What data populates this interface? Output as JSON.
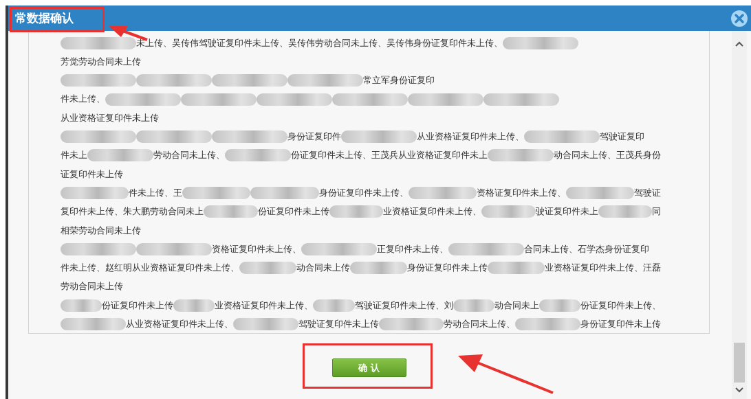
{
  "dialog": {
    "title": "常数据确认",
    "lines": [
      {
        "segments": [
          {
            "kind": "blur"
          },
          {
            "kind": "text",
            "text": "未上传、吴传伟驾驶证复印件未上传、吴传伟劳动合同未上传、吴传伟身份证复印件未上传、"
          },
          {
            "kind": "blur"
          }
        ]
      },
      {
        "segments": [
          {
            "kind": "text",
            "text": "芳觉劳动合同未上传"
          }
        ]
      },
      {
        "segments": [
          {
            "kind": "blur"
          },
          {
            "kind": "blur"
          },
          {
            "kind": "blur"
          },
          {
            "kind": "blur"
          },
          {
            "kind": "text",
            "text": "常立军身份证复印"
          }
        ]
      },
      {
        "segments": [
          {
            "kind": "text",
            "text": "件未上传、"
          },
          {
            "kind": "blur"
          },
          {
            "kind": "blur"
          },
          {
            "kind": "blur"
          },
          {
            "kind": "blur"
          },
          {
            "kind": "blur"
          },
          {
            "kind": "blur"
          }
        ]
      },
      {
        "segments": [
          {
            "kind": "text",
            "text": "从业资格证复印件未上传"
          }
        ]
      },
      {
        "segments": [
          {
            "kind": "blur"
          },
          {
            "kind": "blur"
          },
          {
            "kind": "blur"
          },
          {
            "kind": "text",
            "text": "身份证复印件"
          },
          {
            "kind": "blur"
          },
          {
            "kind": "text",
            "text": "从业资格证复印件未上传、"
          },
          {
            "kind": "blur"
          },
          {
            "kind": "text",
            "text": "驾驶证复印"
          }
        ]
      },
      {
        "segments": [
          {
            "kind": "text",
            "text": "件未上"
          },
          {
            "kind": "blur"
          },
          {
            "kind": "text",
            "text": "劳动合同未上传、"
          },
          {
            "kind": "blur"
          },
          {
            "kind": "text",
            "text": "份证复印件未上传、王茂兵从业资格证复印件未上"
          },
          {
            "kind": "blur"
          },
          {
            "kind": "text",
            "text": "动合同未上传、王茂兵身份"
          }
        ]
      },
      {
        "segments": [
          {
            "kind": "text",
            "text": "证复印件未上传"
          }
        ]
      },
      {
        "segments": [
          {
            "kind": "blur"
          },
          {
            "kind": "text",
            "text": "件未上传、王"
          },
          {
            "kind": "blur"
          },
          {
            "kind": "blur"
          },
          {
            "kind": "text",
            "text": "身份证复印件未上传、"
          },
          {
            "kind": "blur"
          },
          {
            "kind": "text",
            "text": "资格证复印件未上传、"
          },
          {
            "kind": "blur"
          },
          {
            "kind": "text",
            "text": "驾驶证"
          }
        ]
      },
      {
        "segments": [
          {
            "kind": "text",
            "text": "复印件未上传、朱大鹏劳动合同未上"
          },
          {
            "kind": "blur"
          },
          {
            "kind": "text",
            "text": "份证复印件未上传"
          },
          {
            "kind": "blur"
          },
          {
            "kind": "text",
            "text": "业资格证复印件未上传、"
          },
          {
            "kind": "blur"
          },
          {
            "kind": "text",
            "text": "驶证复印件未上"
          },
          {
            "kind": "blur"
          },
          {
            "kind": "text",
            "text": "同"
          }
        ]
      },
      {
        "segments": [
          {
            "kind": "text",
            "text": "相荣劳动合同未上传"
          }
        ]
      },
      {
        "segments": [
          {
            "kind": "blur"
          },
          {
            "kind": "blur"
          },
          {
            "kind": "text",
            "text": "资格证复印件未上传、"
          },
          {
            "kind": "blur"
          },
          {
            "kind": "text",
            "text": "正复印件未上传、"
          },
          {
            "kind": "blur"
          },
          {
            "kind": "text",
            "text": "合同未上传、石学杰身份证复印"
          }
        ]
      },
      {
        "segments": [
          {
            "kind": "text",
            "text": "件未上传、赵红明从业资格证复印件未上传、"
          },
          {
            "kind": "blur"
          },
          {
            "kind": "text",
            "text": "动合同未上传"
          },
          {
            "kind": "blur"
          },
          {
            "kind": "text",
            "text": "身份证复印件未上传"
          },
          {
            "kind": "blur"
          },
          {
            "kind": "text",
            "text": "业资格证复印件未上传、汪磊"
          }
        ]
      },
      {
        "segments": [
          {
            "kind": "text",
            "text": "劳动合同未上传"
          }
        ]
      },
      {
        "segments": [
          {
            "kind": "blur"
          },
          {
            "kind": "text",
            "text": "份证复印件未上传"
          },
          {
            "kind": "blur"
          },
          {
            "kind": "text",
            "text": "业资格证复印件未上传、"
          },
          {
            "kind": "blur"
          },
          {
            "kind": "text",
            "text": "驾驶证复印件未上传、刘"
          },
          {
            "kind": "blur"
          },
          {
            "kind": "text",
            "text": "动合同未上"
          },
          {
            "kind": "blur"
          },
          {
            "kind": "text",
            "text": "份证复印件未上传、"
          }
        ]
      },
      {
        "segments": [
          {
            "kind": "blur"
          },
          {
            "kind": "text",
            "text": "从业资格证复印件未上传、"
          },
          {
            "kind": "blur"
          },
          {
            "kind": "text",
            "text": "驾驶证复印件未上传"
          },
          {
            "kind": "blur"
          },
          {
            "kind": "text",
            "text": "劳动合同未上传、"
          },
          {
            "kind": "blur"
          },
          {
            "kind": "text",
            "text": "身份证复印件未上传"
          }
        ]
      }
    ],
    "confirm_button": "确 认"
  }
}
